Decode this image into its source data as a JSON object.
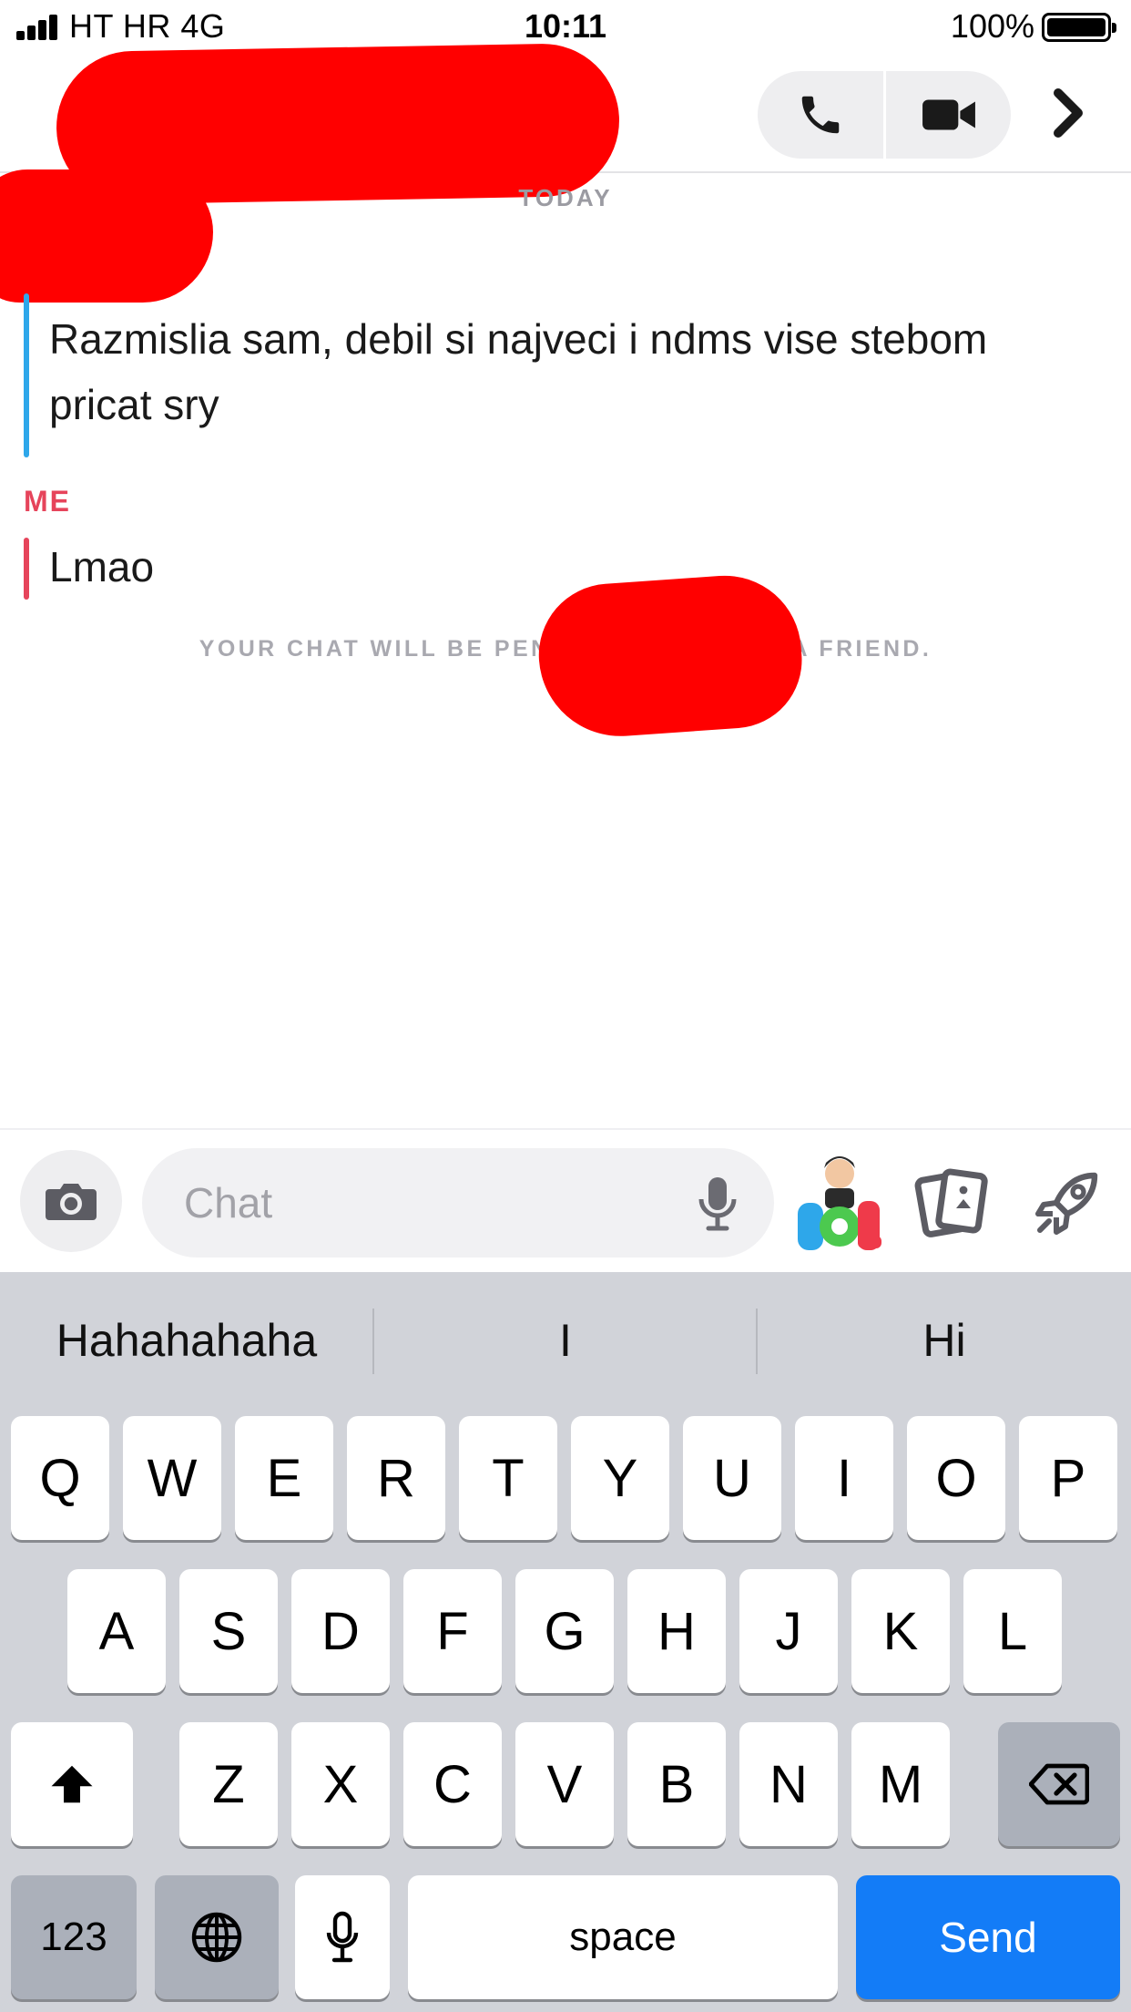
{
  "status_bar": {
    "carrier": "HT HR   4G",
    "time": "10:11",
    "battery_percent": "100%"
  },
  "header": {
    "icons": {
      "call": "phone-icon",
      "video": "video-camera-icon",
      "more": "chevron-right-icon"
    }
  },
  "messages": {
    "day_label": "TODAY",
    "items": [
      {
        "text": "Razmislia sam, debil si najveci i ndms vise stebom pricat sry",
        "bar_color": "#2ea7ea"
      },
      {
        "sender": "ME",
        "text": "Lmao",
        "bar_color": "#e6445b"
      }
    ],
    "pending_note": "YOUR CHAT WILL BE PENDING UN                    YOU AS A FRIEND."
  },
  "compose": {
    "placeholder": "Chat",
    "icons": {
      "camera": "camera-icon",
      "mic": "microphone-icon",
      "bitmoji": "bitmoji-lol-sticker",
      "cards": "cards-icon",
      "games": "rocket-icon"
    }
  },
  "keyboard": {
    "suggestions": [
      "Hahahahaha",
      "I",
      "Hi"
    ],
    "row1": [
      "Q",
      "W",
      "E",
      "R",
      "T",
      "Y",
      "U",
      "I",
      "O",
      "P"
    ],
    "row2": [
      "A",
      "S",
      "D",
      "F",
      "G",
      "H",
      "J",
      "K",
      "L"
    ],
    "row3": [
      "Z",
      "X",
      "C",
      "V",
      "B",
      "N",
      "M"
    ],
    "numbers_label": "123",
    "space_label": "space",
    "send_label": "Send",
    "send_color": "#137cf7"
  }
}
